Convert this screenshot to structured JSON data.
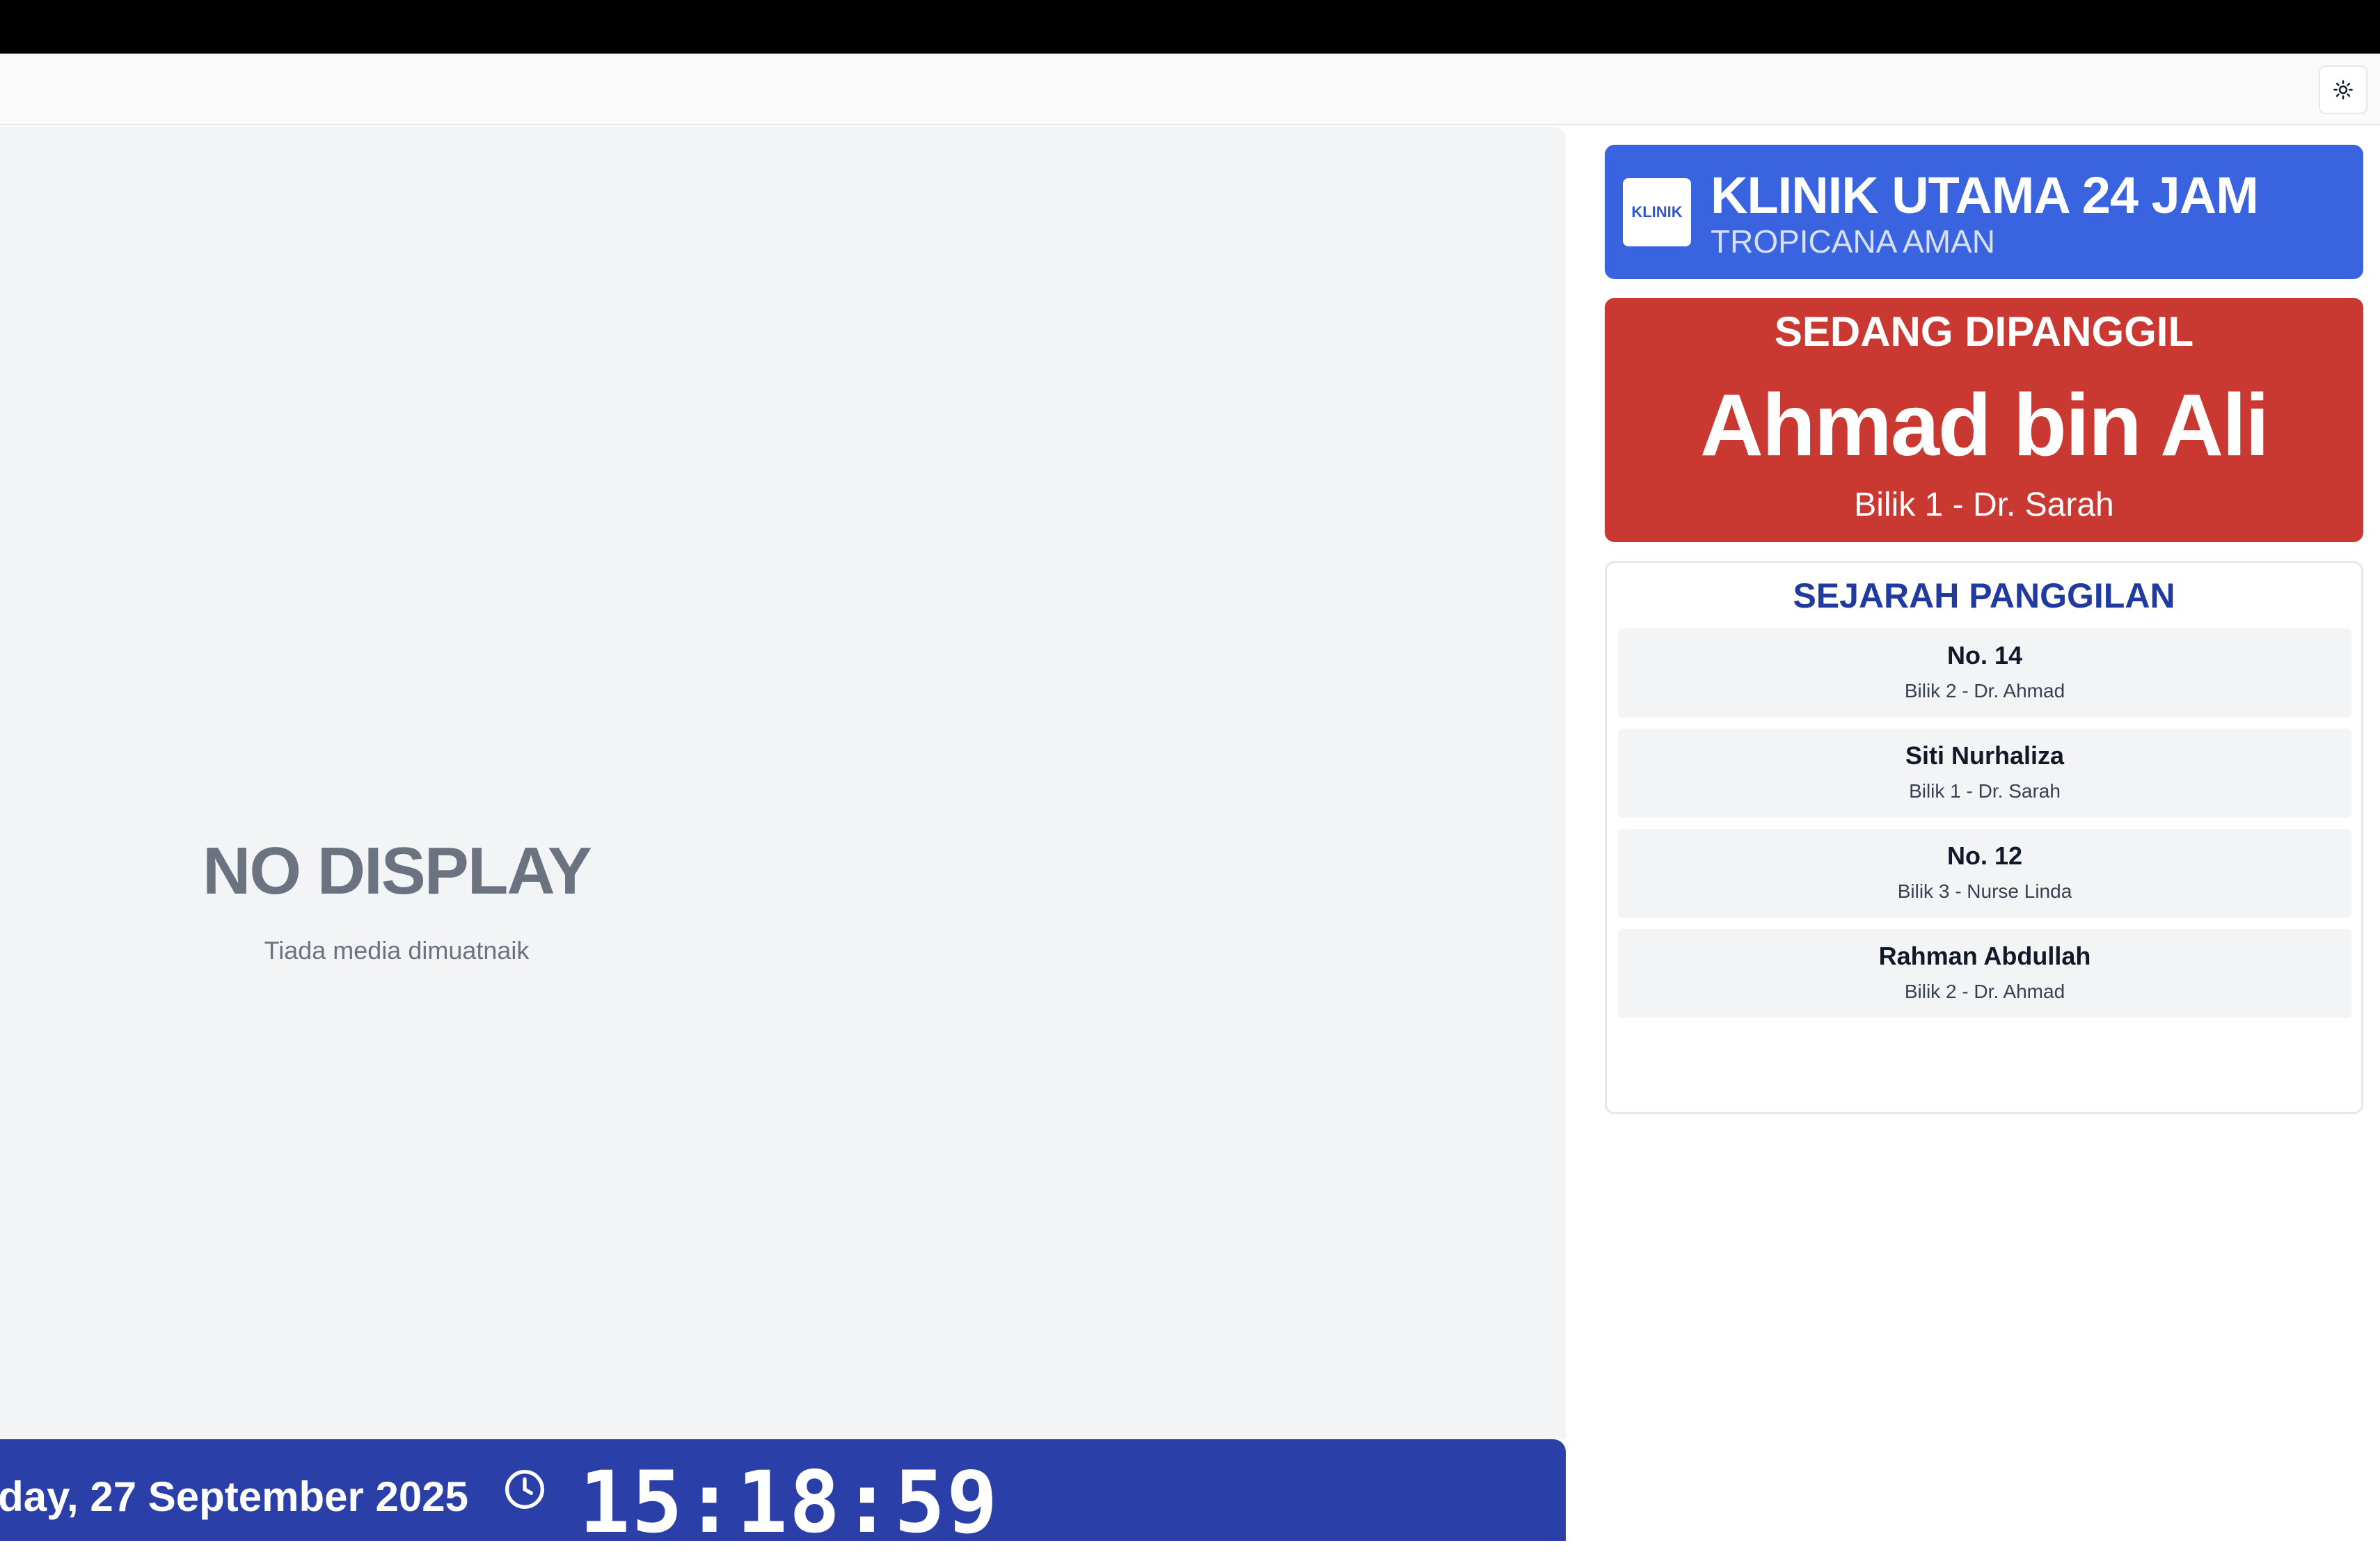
{
  "toolbar": {
    "theme_toggle_icon": "sun-icon"
  },
  "media": {
    "title": "NO DISPLAY",
    "subtitle": "Tiada media dimuatnaik"
  },
  "footer": {
    "date": "day, 27 September 2025",
    "clock_icon": "clock-icon",
    "time": "15:18:59"
  },
  "clinic": {
    "logo_text": "KLINIK",
    "name": "KLINIK UTAMA 24 JAM",
    "subtitle": "TROPICANA AMAN",
    "color": "#3a63e0"
  },
  "now_calling": {
    "label": "SEDANG DIPANGGIL",
    "name": "Ahmad bin Ali",
    "room": "Bilik 1 - Dr. Sarah",
    "color": "#c93932"
  },
  "history": {
    "title": "SEJARAH PANGGILAN",
    "items": [
      {
        "main": "No. 14",
        "room": "Bilik 2 - Dr. Ahmad"
      },
      {
        "main": "Siti Nurhaliza",
        "room": "Bilik 1 - Dr. Sarah"
      },
      {
        "main": "No. 12",
        "room": "Bilik 3 - Nurse Linda"
      },
      {
        "main": "Rahman Abdullah",
        "room": "Bilik 2 - Dr. Ahmad"
      }
    ]
  }
}
